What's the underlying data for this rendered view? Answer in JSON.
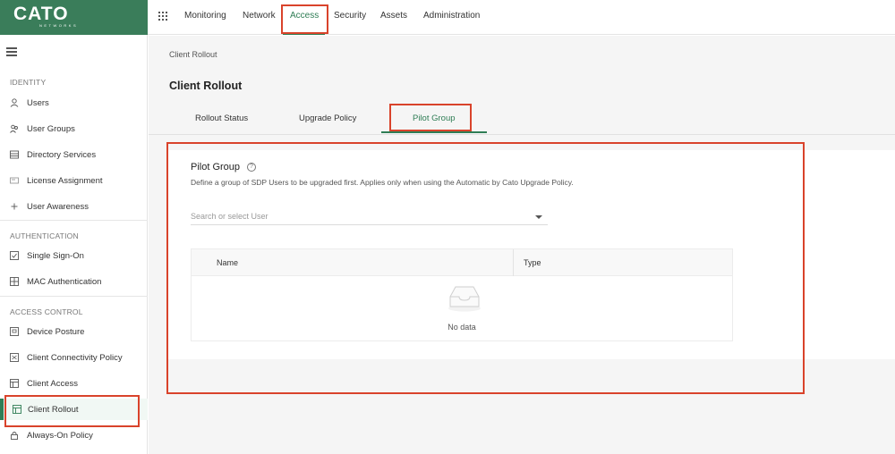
{
  "logo": {
    "brand": "CATO",
    "sub": "NETWORKS"
  },
  "topnav": {
    "items": [
      "Monitoring",
      "Network",
      "Access",
      "Security",
      "Assets",
      "Administration"
    ],
    "active": "Access"
  },
  "sidebar": {
    "sections": [
      {
        "title": "IDENTITY",
        "items": [
          "Users",
          "User Groups",
          "Directory Services",
          "License Assignment",
          "User Awareness"
        ]
      },
      {
        "title": "AUTHENTICATION",
        "items": [
          "Single Sign-On",
          "MAC Authentication"
        ]
      },
      {
        "title": "ACCESS CONTROL",
        "items": [
          "Device Posture",
          "Client Connectivity Policy",
          "Client Access",
          "Client Rollout",
          "Always-On Policy"
        ]
      }
    ],
    "active": "Client Rollout"
  },
  "main": {
    "breadcrumb": "Client Rollout",
    "title": "Client Rollout",
    "tabs": [
      "Rollout Status",
      "Upgrade Policy",
      "Pilot Group"
    ],
    "active_tab": "Pilot Group",
    "panel": {
      "title": "Pilot Group",
      "help_glyph": "?",
      "description": "Define a group of SDP Users to be upgraded first. Applies only when using the Automatic by Cato Upgrade Policy.",
      "search_placeholder": "Search or select User",
      "columns": [
        "Name",
        "Type"
      ],
      "empty_text": "No data"
    }
  },
  "colors": {
    "accent": "#2f7d55",
    "logo_bg": "#3a7d5a",
    "highlight": "#d9432b"
  }
}
